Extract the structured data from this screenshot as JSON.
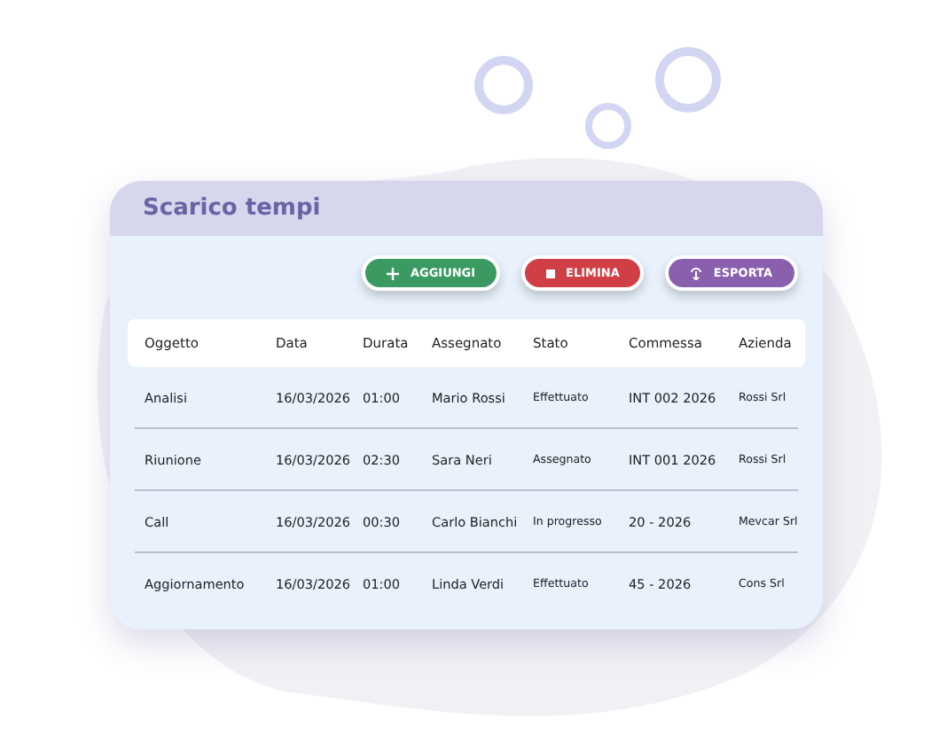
{
  "card": {
    "title": "Scarico tempi"
  },
  "buttons": [
    {
      "label": "AGGIUNGI",
      "kind": "add",
      "color": "#3a9a62"
    },
    {
      "label": "ELIMINA",
      "kind": "delete",
      "color": "#cf3f45"
    },
    {
      "label": "ESPORTA",
      "kind": "export",
      "color": "#8a5fae"
    }
  ],
  "table": {
    "columns": [
      "Oggetto",
      "Data",
      "Durata",
      "Assegnato",
      "Stato",
      "Commessa",
      "Azienda"
    ],
    "rows": [
      [
        "Analisi",
        "16/03/2026",
        "01:00",
        "Mario Rossi",
        "Effettuato",
        "INT 002 2026",
        "Rossi Srl"
      ],
      [
        "Riunione",
        "16/03/2026",
        "02:30",
        "Sara Neri",
        "Assegnato",
        "INT 001 2026",
        "Rossi Srl"
      ],
      [
        "Call",
        "16/03/2026",
        "00:30",
        "Carlo Bianchi",
        "In progresso",
        "20 - 2026",
        "Mevcar Srl"
      ],
      [
        "Aggiornamento",
        "16/03/2026",
        "01:00",
        "Linda Verdi",
        "Effettuato",
        "45 - 2026",
        "Cons Srl"
      ]
    ]
  }
}
